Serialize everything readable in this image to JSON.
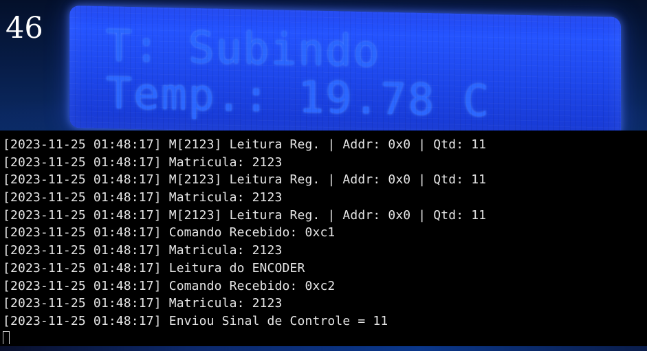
{
  "frame_counter": "46",
  "lcd": {
    "line1": "T: Subindo",
    "line2": "Temp.: 19.78 C"
  },
  "terminal": {
    "lines": [
      "[2023-11-25 01:48:17] M[2123] Leitura Reg. | Addr: 0x0 | Qtd: 11",
      "[2023-11-25 01:48:17] Matricula: 2123",
      "[2023-11-25 01:48:17] M[2123] Leitura Reg. | Addr: 0x0 | Qtd: 11",
      "[2023-11-25 01:48:17] Matricula: 2123",
      "[2023-11-25 01:48:17] M[2123] Leitura Reg. | Addr: 0x0 | Qtd: 11",
      "[2023-11-25 01:48:17] Comando Recebido: 0xc1",
      "[2023-11-25 01:48:17] Matricula: 2123",
      "[2023-11-25 01:48:17] Leitura do ENCODER",
      "[2023-11-25 01:48:17] Comando Recebido: 0xc2",
      "[2023-11-25 01:48:17] Matricula: 2123",
      "[2023-11-25 01:48:17] Enviou Sinal de Controle = 11"
    ]
  }
}
